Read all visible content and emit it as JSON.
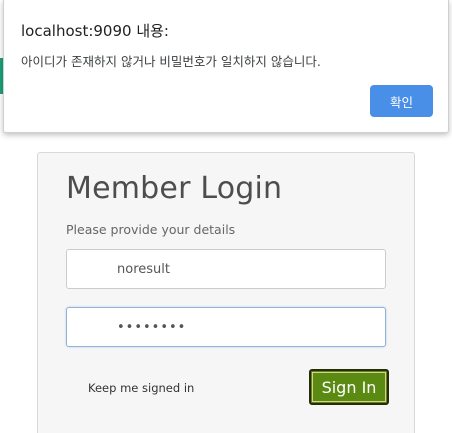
{
  "alert": {
    "title": "localhost:9090 내용:",
    "message": "아이디가 존재하지 않거나 비밀번호가 일치하지 않습니다.",
    "ok_label": "확인"
  },
  "login": {
    "title": "Member Login",
    "subtitle": "Please provide your details",
    "username_value": "noresult",
    "password_value": "••••••••",
    "remember_label": "Keep me signed in",
    "signin_label": "Sign In"
  },
  "colors": {
    "signin_button": "#5a8a12",
    "ok_button": "#4a8fe7",
    "background_accent": "#1aa37a"
  }
}
